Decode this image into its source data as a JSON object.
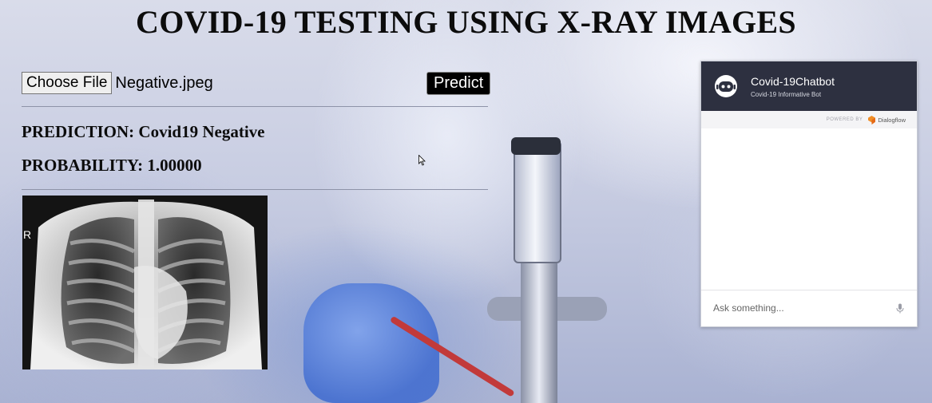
{
  "page": {
    "title": "COVID-19 TESTING USING X-RAY IMAGES"
  },
  "upload": {
    "choose_file_label": "Choose File",
    "file_name": "Negative.jpeg",
    "predict_label": "Predict"
  },
  "result": {
    "prediction_text": "PREDICTION: Covid19 Negative",
    "probability_text": "PROBABILITY: 1.00000",
    "xray_marker": "R"
  },
  "chatbot": {
    "title": "Covid-19Chatbot",
    "subtitle": "Covid-19 Informative Bot",
    "powered_by": "POWERED BY",
    "provider": "Dialogflow",
    "input_placeholder": "Ask something..."
  },
  "colors": {
    "chat_header": "#2d3040",
    "predict_button": "#000000",
    "dialogflow_orange": "#f08e26"
  },
  "icons": [
    "bot-avatar-icon",
    "dialogflow-logo-icon",
    "mic-icon",
    "mouse-cursor-icon"
  ]
}
